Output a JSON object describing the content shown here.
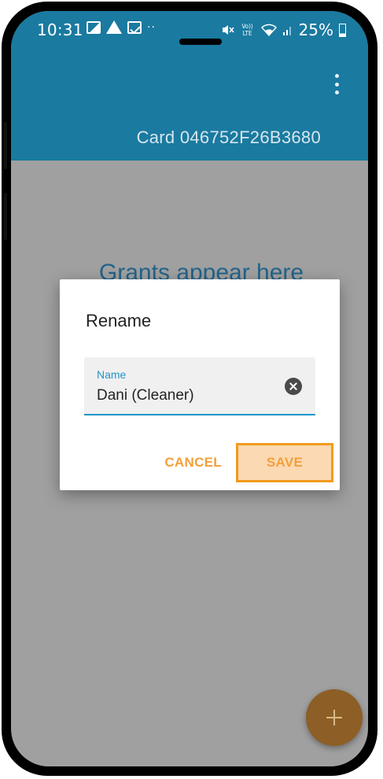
{
  "status_bar": {
    "time": "10:31",
    "dots": "··",
    "volte": "Vo))\nLTE",
    "battery": "25%"
  },
  "app_bar": {
    "title": "Card 046752F26B3680",
    "color": "#1a7aa0"
  },
  "main": {
    "empty_text": "Grants appear here"
  },
  "dialog": {
    "title": "Rename",
    "field": {
      "label": "Name",
      "value": "Dani (Cleaner)"
    },
    "cancel_label": "CANCEL",
    "save_label": "SAVE",
    "accent_color": "#f2a03a",
    "highlight_color": "#f39a1e"
  },
  "icons": {
    "status_left": [
      "image-icon",
      "warning-icon",
      "gallery-icon"
    ],
    "status_right": [
      "mute-icon",
      "volte-icon",
      "wifi-icon",
      "signal-icon",
      "battery-icon"
    ],
    "menu": "more-vert-icon",
    "clear": "clear-icon",
    "fab": "add-icon"
  }
}
